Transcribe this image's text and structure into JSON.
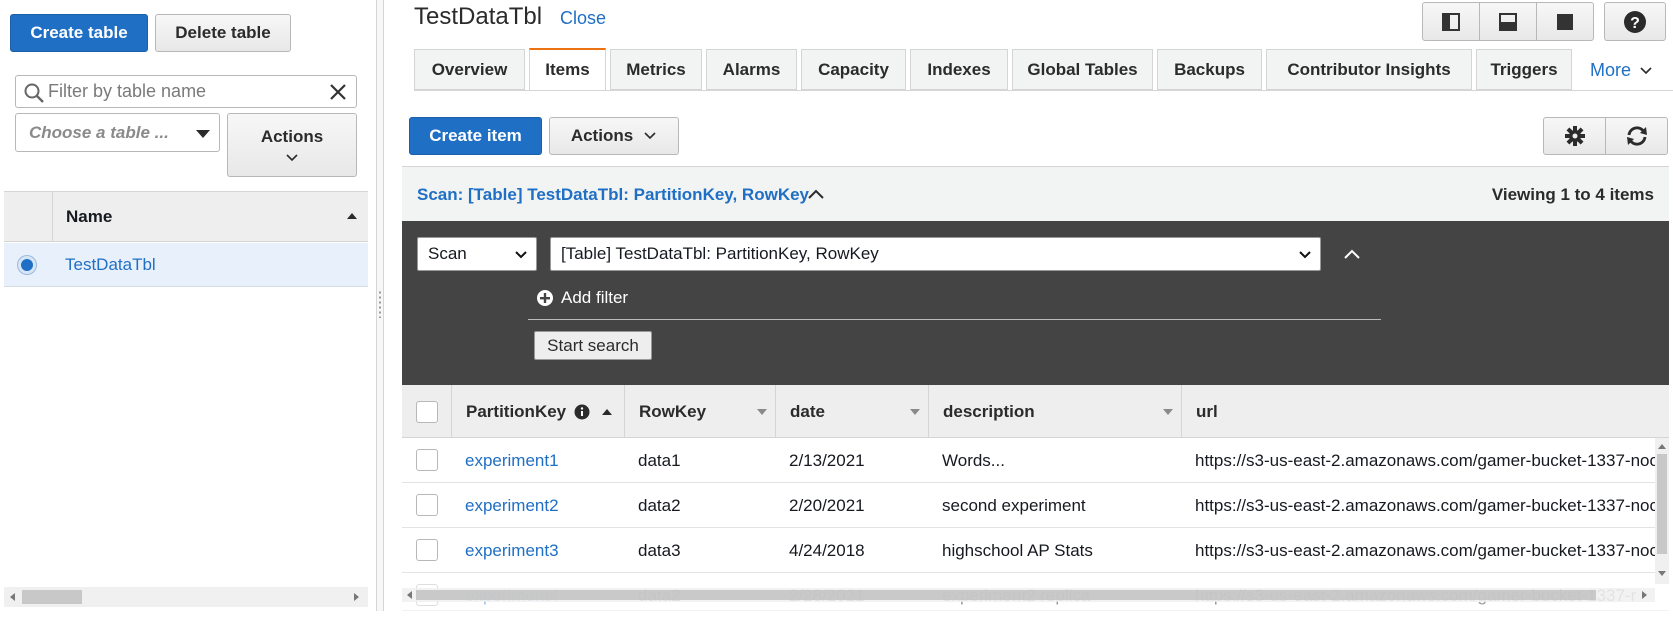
{
  "left": {
    "create_table": "Create table",
    "delete_table": "Delete table",
    "filter_placeholder": "Filter by table name",
    "choose_table_placeholder": "Choose a table ...",
    "actions": "Actions",
    "column_name": "Name",
    "tables": [
      {
        "name": "TestDataTbl",
        "selected": true
      }
    ]
  },
  "header": {
    "table_title": "TestDataTbl",
    "close": "Close"
  },
  "tabs": [
    {
      "label": "Overview",
      "active": false
    },
    {
      "label": "Items",
      "active": true
    },
    {
      "label": "Metrics",
      "active": false
    },
    {
      "label": "Alarms",
      "active": false
    },
    {
      "label": "Capacity",
      "active": false
    },
    {
      "label": "Indexes",
      "active": false
    },
    {
      "label": "Global Tables",
      "active": false
    },
    {
      "label": "Backups",
      "active": false
    },
    {
      "label": "Contributor Insights",
      "active": false
    },
    {
      "label": "Triggers",
      "active": false
    }
  ],
  "more_tab": "More",
  "toolbar": {
    "create_item": "Create item",
    "actions": "Actions"
  },
  "scan": {
    "summary": "Scan: [Table] TestDataTbl: PartitionKey, RowKey",
    "viewing": "Viewing 1 to 4 items",
    "mode": "Scan",
    "target": "[Table] TestDataTbl: PartitionKey, RowKey",
    "add_filter": "Add filter",
    "start_search": "Start search"
  },
  "items_table": {
    "columns": [
      "PartitionKey",
      "RowKey",
      "date",
      "description",
      "url"
    ],
    "rows": [
      {
        "PartitionKey": "experiment1",
        "RowKey": "data1",
        "date": "2/13/2021",
        "description": "Words...",
        "url": "https://s3-us-east-2.amazonaws.com/gamer-bucket-1337-noc"
      },
      {
        "PartitionKey": "experiment2",
        "RowKey": "data2",
        "date": "2/20/2021",
        "description": "second experiment",
        "url": "https://s3-us-east-2.amazonaws.com/gamer-bucket-1337-noc"
      },
      {
        "PartitionKey": "experiment3",
        "RowKey": "data3",
        "date": "4/24/2018",
        "description": "highschool AP Stats",
        "url": "https://s3-us-east-2.amazonaws.com/gamer-bucket-1337-noc"
      },
      {
        "PartitionKey": "experiment4",
        "RowKey": "data2",
        "date": "2/28/2021",
        "description": "experiment2 replica",
        "url": "https://s3-us-east-2.amazonaws.com/gamer-bucket-1337-r"
      }
    ]
  },
  "icons": {
    "layout_split_vertical": "split-vertical-icon",
    "layout_split_horizontal": "split-horizontal-icon",
    "layout_full": "full-view-icon",
    "help": "help-icon",
    "settings": "gear-icon",
    "refresh": "refresh-icon"
  },
  "colors": {
    "primary": "#1f6fc5",
    "active_tab_accent": "#ec7211",
    "query_panel": "#444444"
  }
}
